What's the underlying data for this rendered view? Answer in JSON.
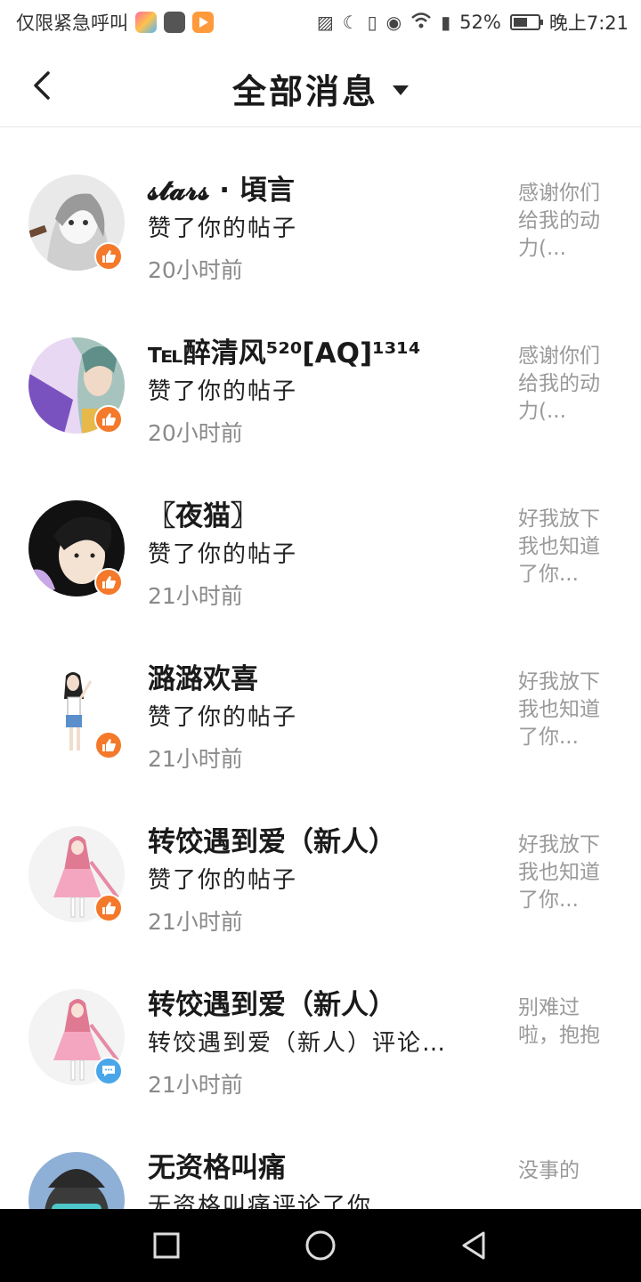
{
  "status_bar": {
    "carrier": "仅限紧急呼叫",
    "battery": "52%",
    "time": "晚上7:21",
    "icons": [
      "sim-off-icon",
      "moon-icon",
      "vibrate-icon",
      "eye-icon",
      "wifi-icon",
      "battery-alert-icon",
      "battery-icon"
    ]
  },
  "header": {
    "title": "全部消息"
  },
  "messages": [
    {
      "name": "𝓼𝓽𝓪𝓻𝓼 · 頃言",
      "action": "赞了你的帖子",
      "time": "20小时前",
      "preview": "感谢你们给我的动力(...",
      "type": "like"
    },
    {
      "name": "℡醉清风⁵²⁰[AQ]¹³¹⁴",
      "action": "赞了你的帖子",
      "time": "20小时前",
      "preview": "感谢你们给我的动力(...",
      "type": "like"
    },
    {
      "name": "〖夜猫〗",
      "action": "赞了你的帖子",
      "time": "21小时前",
      "preview": "好我放下我也知道了你...",
      "type": "like"
    },
    {
      "name": "潞潞欢喜",
      "action": "赞了你的帖子",
      "time": "21小时前",
      "preview": "好我放下我也知道了你...",
      "type": "like"
    },
    {
      "name": "转饺遇到爱（新人）",
      "action": "赞了你的帖子",
      "time": "21小时前",
      "preview": "好我放下我也知道了你...",
      "type": "like"
    },
    {
      "name": "转饺遇到爱（新人）",
      "action": "转饺遇到爱（新人）评论…",
      "time": "21小时前",
      "preview": "别难过啦，抱抱",
      "type": "comment"
    },
    {
      "name": "无资格叫痛",
      "action": "无资格叫痛评论了你",
      "time": "",
      "preview": "没事的",
      "type": "comment"
    }
  ],
  "colors": {
    "like_badge": "#f4792b",
    "comment_badge": "#4aa6e8"
  },
  "nav": [
    "recent-apps-icon",
    "home-icon",
    "back-icon"
  ]
}
